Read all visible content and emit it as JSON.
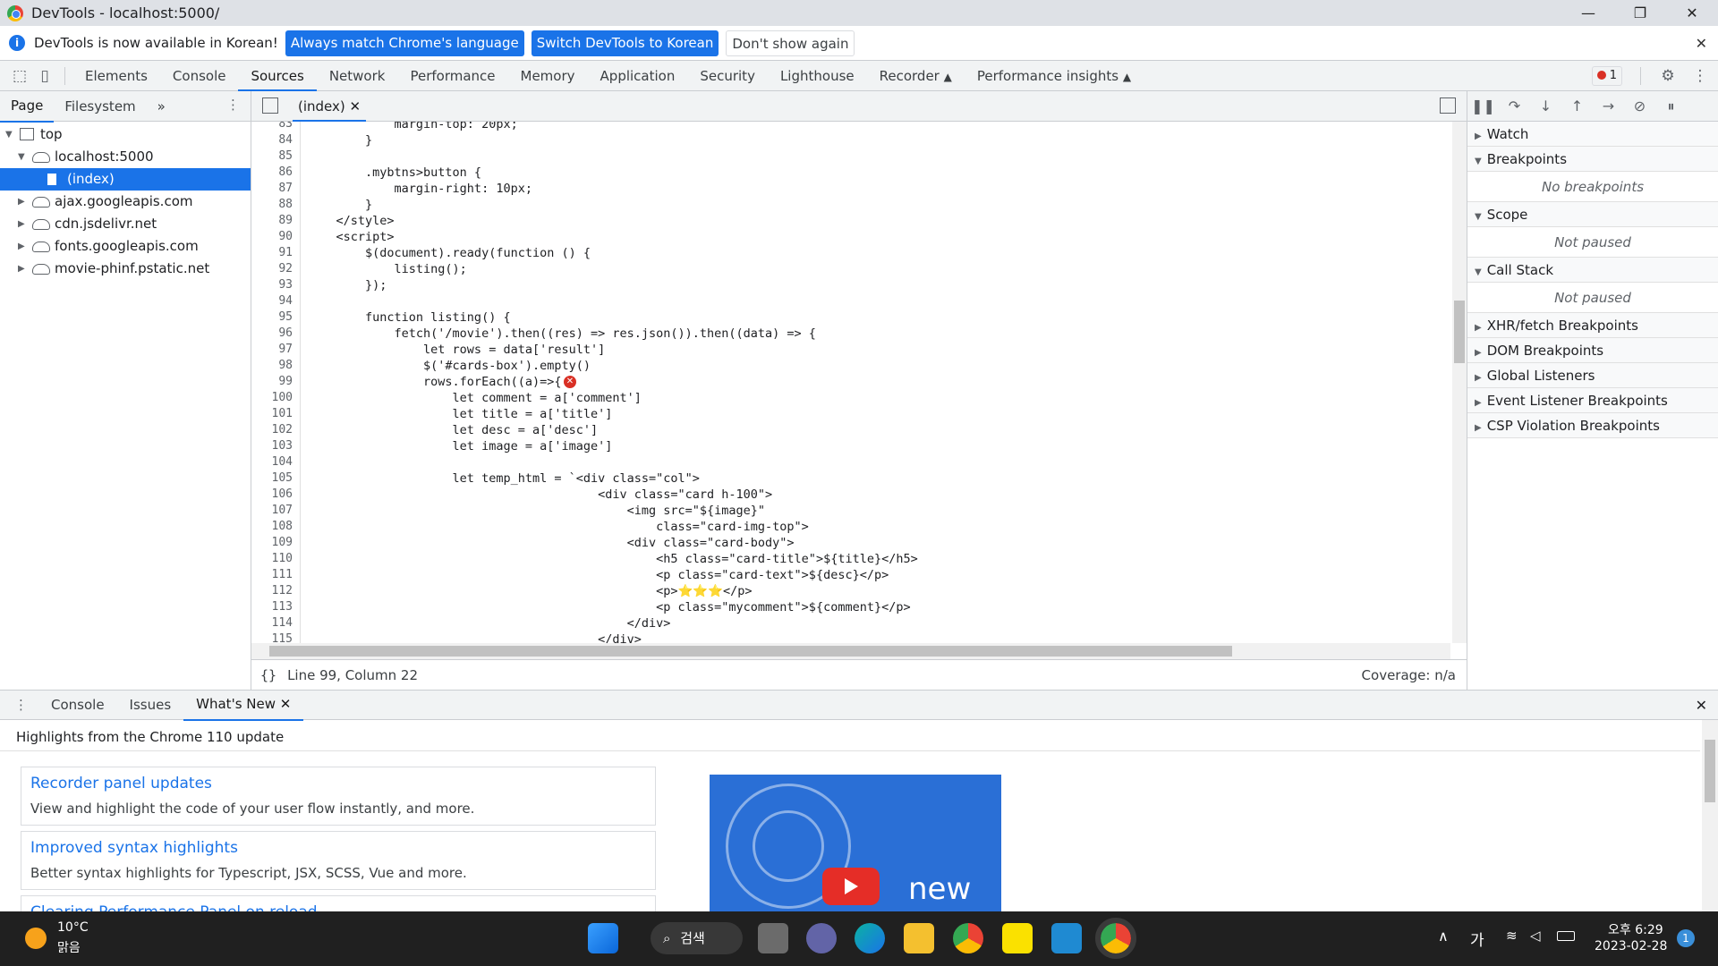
{
  "window": {
    "title": "DevTools - localhost:5000/",
    "minimize": "—",
    "maximize": "❐",
    "close": "✕"
  },
  "infobar": {
    "message": "DevTools is now available in Korean!",
    "btn_match": "Always match Chrome's language",
    "btn_switch": "Switch DevTools to Korean",
    "btn_dismiss": "Don't show again"
  },
  "tabs": [
    "Elements",
    "Console",
    "Sources",
    "Network",
    "Performance",
    "Memory",
    "Application",
    "Security",
    "Lighthouse",
    "Recorder",
    "Performance insights"
  ],
  "active_tab": "Sources",
  "error_count": "1",
  "navigator": {
    "tabs": [
      "Page",
      "Filesystem"
    ],
    "tree": [
      "top",
      "localhost:5000",
      "(index)",
      "ajax.googleapis.com",
      "cdn.jsdelivr.net",
      "fonts.googleapis.com",
      "movie-phinf.pstatic.net"
    ]
  },
  "editor": {
    "file_tab": "(index)",
    "lines": [
      {
        "n": "83",
        "t": "            margin-top: 20px;"
      },
      {
        "n": "84",
        "t": "        }"
      },
      {
        "n": "85",
        "t": ""
      },
      {
        "n": "86",
        "t": "        .mybtns>button {"
      },
      {
        "n": "87",
        "t": "            margin-right: 10px;"
      },
      {
        "n": "88",
        "t": "        }"
      },
      {
        "n": "89",
        "t": "    </style>"
      },
      {
        "n": "90",
        "t": "    <script>"
      },
      {
        "n": "91",
        "t": "        $(document).ready(function () {"
      },
      {
        "n": "92",
        "t": "            listing();"
      },
      {
        "n": "93",
        "t": "        });"
      },
      {
        "n": "94",
        "t": ""
      },
      {
        "n": "95",
        "t": "        function listing() {"
      },
      {
        "n": "96",
        "t": "            fetch('/movie').then((res) => res.json()).then((data) => {"
      },
      {
        "n": "97",
        "t": "                let rows = data['result']"
      },
      {
        "n": "98",
        "t": "                $('#cards-box').empty()"
      },
      {
        "n": "99",
        "t": "                rows.forEach((a)=>{"
      },
      {
        "n": "100",
        "t": "                    let comment = a['comment']"
      },
      {
        "n": "101",
        "t": "                    let title = a['title']"
      },
      {
        "n": "102",
        "t": "                    let desc = a['desc']"
      },
      {
        "n": "103",
        "t": "                    let image = a['image']"
      },
      {
        "n": "104",
        "t": ""
      },
      {
        "n": "105",
        "t": "                    let temp_html = `<div class=\"col\">"
      },
      {
        "n": "106",
        "t": "                                        <div class=\"card h-100\">"
      },
      {
        "n": "107",
        "t": "                                            <img src=\"${image}\""
      },
      {
        "n": "108",
        "t": "                                                class=\"card-img-top\">"
      },
      {
        "n": "109",
        "t": "                                            <div class=\"card-body\">"
      },
      {
        "n": "110",
        "t": "                                                <h5 class=\"card-title\">${title}</h5>"
      },
      {
        "n": "111",
        "t": "                                                <p class=\"card-text\">${desc}</p>"
      },
      {
        "n": "112",
        "t": "                                                <p>⭐⭐⭐</p>"
      },
      {
        "n": "113",
        "t": "                                                <p class=\"mycomment\">${comment}</p>"
      },
      {
        "n": "114",
        "t": "                                            </div>"
      },
      {
        "n": "115",
        "t": "                                        </div>"
      }
    ]
  },
  "status": {
    "position": "Line 99, Column 22",
    "coverage": "Coverage: n/a"
  },
  "debugger": {
    "sections": [
      {
        "label": "Watch",
        "open": false,
        "body": ""
      },
      {
        "label": "Breakpoints",
        "open": true,
        "body": "No breakpoints"
      },
      {
        "label": "Scope",
        "open": true,
        "body": "Not paused"
      },
      {
        "label": "Call Stack",
        "open": true,
        "body": "Not paused"
      },
      {
        "label": "XHR/fetch Breakpoints",
        "open": false,
        "body": ""
      },
      {
        "label": "DOM Breakpoints",
        "open": false,
        "body": ""
      },
      {
        "label": "Global Listeners",
        "open": false,
        "body": ""
      },
      {
        "label": "Event Listener Breakpoints",
        "open": false,
        "body": ""
      },
      {
        "label": "CSP Violation Breakpoints",
        "open": false,
        "body": ""
      }
    ]
  },
  "drawer": {
    "tabs": [
      "Console",
      "Issues",
      "What's New"
    ],
    "heading": "Highlights from the Chrome 110 update",
    "cards": [
      {
        "title": "Recorder panel updates",
        "desc": "View and highlight the code of your user flow instantly, and more."
      },
      {
        "title": "Improved syntax highlights",
        "desc": "Better syntax highlights for Typescript, JSX, SCSS, Vue and more."
      },
      {
        "title": "Clearing Performance Panel on reload",
        "desc": ""
      }
    ],
    "video_text": "new"
  },
  "taskbar": {
    "weather_temp": "10°C",
    "weather_desc": "맑음",
    "search": "검색",
    "time": "오후 6:29",
    "date": "2023-02-28",
    "ime": "가",
    "notif": "1"
  }
}
